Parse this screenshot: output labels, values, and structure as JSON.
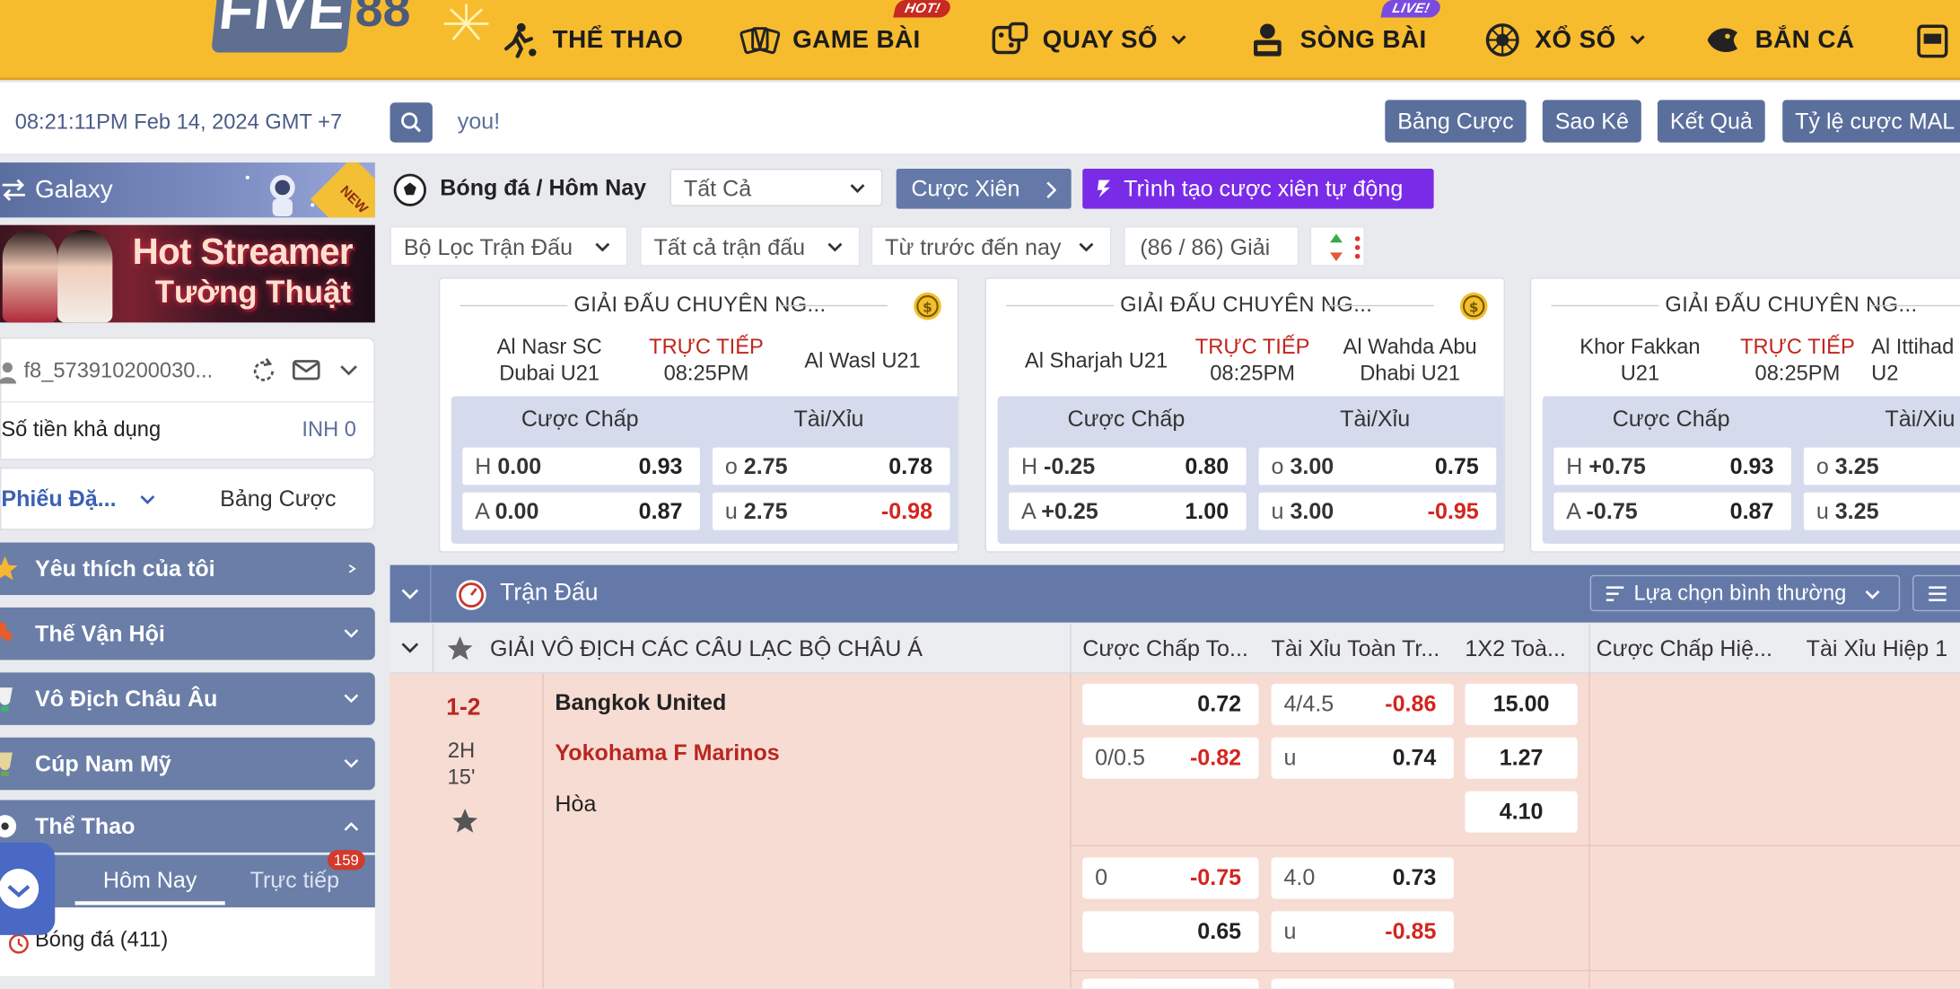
{
  "nav": {
    "logo_text": "FIVE",
    "logo_num": "88",
    "items": [
      {
        "label": "THỂ THAO",
        "badge": ""
      },
      {
        "label": "GAME BÀI",
        "badge": "HOT!"
      },
      {
        "label": "QUAY SỐ",
        "badge": ""
      },
      {
        "label": "SÒNG BÀI",
        "badge": "LIVE!"
      },
      {
        "label": "XỔ SỐ",
        "badge": ""
      },
      {
        "label": "BẮN CÁ",
        "badge": ""
      }
    ]
  },
  "infobar": {
    "datetime": "08:21:11PM Feb 14, 2024 GMT +7",
    "search_text": "you!",
    "buttons": [
      "Bảng Cược",
      "Sao Kê",
      "Kết Quả",
      "Tỷ lệ cược MAL"
    ]
  },
  "sidebar": {
    "galaxy": "Galaxy",
    "galaxy_badge": "NEW",
    "banner_line1": "Hot Streamer",
    "banner_line2": "Tường Thuật",
    "user_id": "f8_573910200030...",
    "balance_label": "Số tiền khả dụng",
    "balance_value": "INH 0",
    "bet_tab_active": "Phiếu Đặ...",
    "bet_tab_other": "Bảng Cược",
    "menu": [
      "Yêu thích của tôi",
      "Thế Vận Hội",
      "Vô Địch Châu Âu",
      "Cúp Nam Mỹ",
      "Thể Thao"
    ],
    "subtabs": {
      "today": "Hôm Nay",
      "live": "Trực tiếp",
      "live_count": "159"
    },
    "sport_item": "Bóng đá  (411)"
  },
  "main": {
    "breadcrumb": "Bóng đá / Hôm Nay",
    "select_all": "Tất Cả",
    "parlay_btn": "Cược Xiên",
    "auto_parlay_btn": "Trình tạo cược xiên tự động",
    "filters": [
      "Bộ Lọc Trận Đấu",
      "Tất cả trận đấu",
      "Từ trước đến nay"
    ],
    "league_count": "(86 / 86) Giải"
  },
  "cards": [
    {
      "league": "GIẢI ĐẤU CHUYÊN NG...",
      "home": "Al Nasr SC\nDubai U21",
      "away": "Al Wasl U21",
      "status": "TRỰC TIẾP",
      "time": "08:25PM",
      "hdr_handicap": "Cược Chấp",
      "hdr_ou": "Tài/Xỉu",
      "h_line": "0.00",
      "h_odds": "0.93",
      "a_line": "0.00",
      "a_odds": "0.87",
      "o_line": "2.75",
      "o_odds": "0.78",
      "u_line": "2.75",
      "u_odds": "-0.98"
    },
    {
      "league": "GIẢI ĐẤU CHUYÊN NG...",
      "home": "Al Sharjah U21",
      "away": "Al Wahda Abu\nDhabi U21",
      "status": "TRỰC TIẾP",
      "time": "08:25PM",
      "hdr_handicap": "Cược Chấp",
      "hdr_ou": "Tài/Xỉu",
      "h_line": "-0.25",
      "h_odds": "0.80",
      "a_line": "+0.25",
      "a_odds": "1.00",
      "o_line": "3.00",
      "o_odds": "0.75",
      "u_line": "3.00",
      "u_odds": "-0.95"
    },
    {
      "league": "GIẢI ĐẤU CHUYÊN NG...",
      "home": "Khor Fakkan\nU21",
      "away": "Al Ittihad\nU2",
      "status": "TRỰC TIẾP",
      "time": "08:25PM",
      "hdr_handicap": "Cược Chấp",
      "hdr_ou": "Tài/Xiu",
      "h_line": "+0.75",
      "h_odds": "0.93",
      "a_line": "-0.75",
      "a_odds": "0.87",
      "o_line": "3.25",
      "o_odds": "",
      "u_line": "3.25",
      "u_odds": ""
    }
  ],
  "section": {
    "title": "Trận Đấu",
    "view_select": "Lựa chọn bình thường"
  },
  "league_row": {
    "name": "GIẢI VÔ ĐỊCH CÁC CÂU LẠC BỘ CHÂU Á",
    "columns": [
      "Cược Chấp To...",
      "Tài Xỉu Toàn Tr...",
      "1X2 Toà...",
      "Cược Chấp Hiệ...",
      "Tài Xỉu Hiệp 1"
    ]
  },
  "match": {
    "score": "1-2",
    "period": "2H",
    "minute": "15'",
    "home": "Bangkok United",
    "away": "Yokohama F Marinos",
    "draw": "Hòa",
    "hdp1_home_odds": "0.72",
    "hdp1_away_line": "0/0.5",
    "hdp1_away_odds": "-0.82",
    "ou1_line": "4/4.5",
    "ou1_over": "-0.86",
    "ou1_u": "u",
    "ou1_under": "0.74",
    "x12_home": "15.00",
    "x12_away": "1.27",
    "x12_draw": "4.10",
    "hdp2_line": "0",
    "hdp2_home_odds": "-0.75",
    "hdp2_away_odds": "0.65",
    "ou2_line": "4.0",
    "ou2_over": "0.73",
    "ou2_u": "u",
    "ou2_under": "-0.85"
  }
}
